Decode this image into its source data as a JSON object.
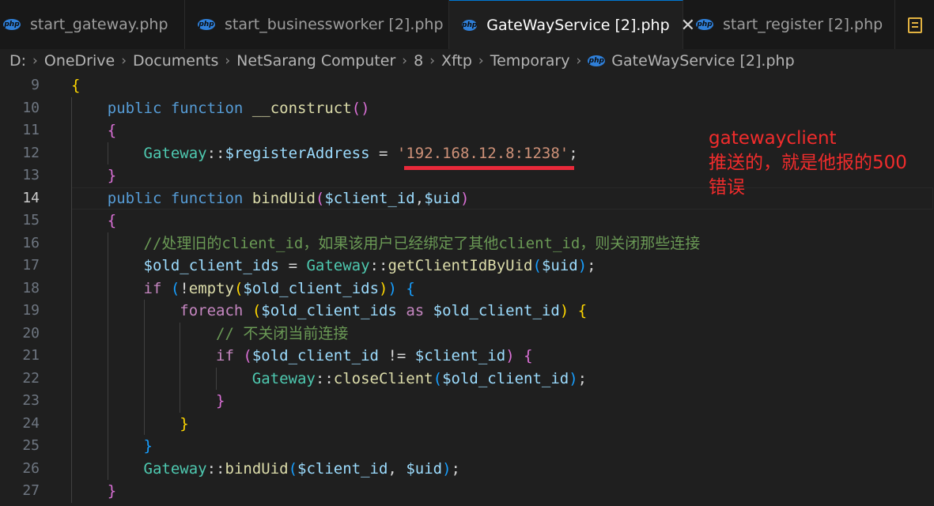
{
  "tabs": [
    {
      "label": "start_gateway.php",
      "icon": "php-icon",
      "active": false
    },
    {
      "label": "start_businessworker [2].php",
      "icon": "php-icon",
      "active": false
    },
    {
      "label": "GateWayService [2].php",
      "icon": "php-icon",
      "active": true
    },
    {
      "label": "start_register [2].php",
      "icon": "php-icon",
      "active": false
    }
  ],
  "tab_icon_text": "php",
  "close_glyph": "✕",
  "breadcrumb": [
    "D:",
    "OneDrive",
    "Documents",
    "NetSarang Computer",
    "8",
    "Xftp",
    "Temporary",
    "GateWayService [2].php"
  ],
  "breadcrumb_sep": "›",
  "code": {
    "current_line": 14,
    "lines": [
      {
        "n": 9,
        "t": "{"
      },
      {
        "n": 10,
        "t": "    public function __construct()"
      },
      {
        "n": 11,
        "t": "    {"
      },
      {
        "n": 12,
        "t": "        Gateway::$registerAddress = '192.168.12.8:1238';"
      },
      {
        "n": 13,
        "t": "    }"
      },
      {
        "n": 14,
        "t": "    public function bindUid($client_id,$uid)"
      },
      {
        "n": 15,
        "t": "    {"
      },
      {
        "n": 16,
        "t": "        //处理旧的client_id，如果该用户已经绑定了其他client_id，则关闭那些连接"
      },
      {
        "n": 17,
        "t": "        $old_client_ids = Gateway::getClientIdByUid($uid);"
      },
      {
        "n": 18,
        "t": "        if (!empty($old_client_ids)) {"
      },
      {
        "n": 19,
        "t": "            foreach ($old_client_ids as $old_client_id) {"
      },
      {
        "n": 20,
        "t": "                // 不关闭当前连接"
      },
      {
        "n": 21,
        "t": "                if ($old_client_id != $client_id) {"
      },
      {
        "n": 22,
        "t": "                    Gateway::closeClient($old_client_id);"
      },
      {
        "n": 23,
        "t": "                }"
      },
      {
        "n": 24,
        "t": "            }"
      },
      {
        "n": 25,
        "t": "        }"
      },
      {
        "n": 26,
        "t": "        Gateway::bindUid($client_id, $uid);"
      },
      {
        "n": 27,
        "t": "    }"
      }
    ]
  },
  "annotation": {
    "line1": "gatewayclient",
    "line2": "推送的，就是他报的500",
    "line3": "错误",
    "color": "#f02c2c"
  },
  "colors": {
    "keyword": "#569cd6",
    "function": "#dcdcaa",
    "class": "#4ec9b0",
    "variable": "#9cdcfe",
    "string": "#ce9178",
    "comment": "#6a9955",
    "underline": "#e8293a",
    "active_tab_border": "#0078d4"
  }
}
